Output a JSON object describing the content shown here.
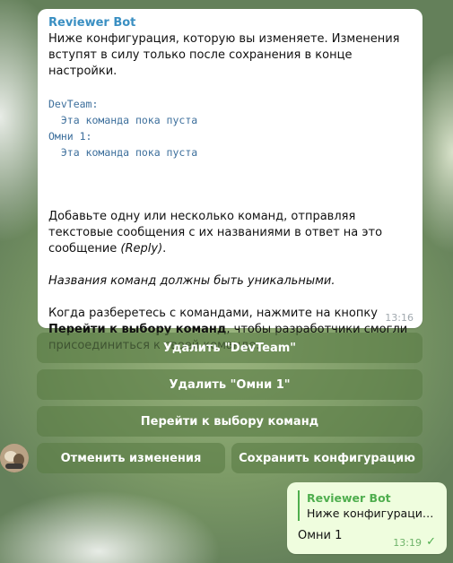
{
  "message": {
    "sender": "Reviewer Bot",
    "intro": "Ниже конфигурация, которую вы изменяете. Изменения вступят в силу только после сохранения в конце настройки.",
    "teams": [
      {
        "name": "DevTeam:",
        "status": "Эта команда пока пуста"
      },
      {
        "name": "Омни 1:",
        "status": "Эта команда пока пуста"
      }
    ],
    "add_text": "Добавьте одну или несколько команд, отправляя текстовые сообщения с их названиями в ответ на это сообщение ",
    "add_reply": "(Reply)",
    "add_end": ".",
    "unique_note": "Названия команд должны быть уникальными.",
    "final_pre": "Когда разберетесь с командами, нажмите на кнопку ",
    "final_bold": "Перейти к выбору команд",
    "final_post": ", чтобы разработчики смогли присоединиться к своей команде.",
    "time": "13:16"
  },
  "keyboard": {
    "delete_devteam": "Удалить \"DevTeam\"",
    "delete_omni": "Удалить \"Омни 1\"",
    "goto_select": "Перейти к выбору команд",
    "cancel": "Отменить изменения",
    "save": "Сохранить конфигурацию"
  },
  "outgoing": {
    "reply_name": "Reviewer Bot",
    "reply_text": "Ниже конфигурация, ...",
    "text": "Омни 1",
    "time": "13:19"
  }
}
